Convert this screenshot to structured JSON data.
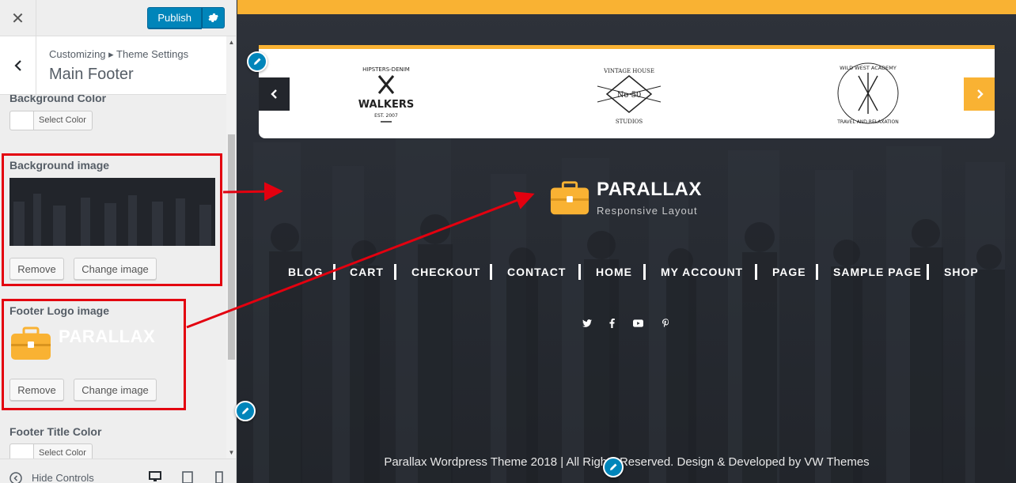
{
  "sidebar": {
    "close_icon": "close-icon",
    "publish_label": "Publish",
    "breadcrumb": "Customizing ▸ Theme Settings",
    "section_title": "Main Footer",
    "controls": {
      "background_color_label": "Background Color",
      "select_color_label": "Select Color",
      "background_image_label": "Background image",
      "remove_label": "Remove",
      "change_image_label": "Change image",
      "footer_logo_label": "Footer Logo image",
      "logo_preview_name": "PARALLAX",
      "logo_preview_tag": "Responsive Layout",
      "footer_title_color_label": "Footer Title Color",
      "select_color_label_2": "Select Color"
    },
    "hide_controls": "Hide Controls"
  },
  "preview": {
    "footer_logo": {
      "name": "PARALLAX",
      "tagline": "Responsive Layout"
    },
    "nav": [
      "BLOG",
      "CART",
      "CHECKOUT",
      "CONTACT",
      "HOME",
      "MY ACCOUNT",
      "PAGE",
      "SAMPLE PAGE",
      "SHOP"
    ],
    "social": [
      "twitter-icon",
      "facebook-icon",
      "youtube-icon",
      "pinterest-icon"
    ],
    "copyright": "Parallax Wordpress Theme 2018 | All Rights Reserved. Design & Developed by VW Themes",
    "brands": [
      {
        "top": "HIPSTERS-DENIM",
        "name": "WALKERS",
        "sub": "EST. 2007"
      },
      {
        "top": "VINTAGE HOUSE",
        "name": "No 50",
        "sub": "STUDIOS"
      },
      {
        "top": "WILD WEST ACADEMY",
        "name": "",
        "sub": "TRAVEL AND RELAXATION"
      }
    ]
  },
  "colors": {
    "accent": "#f9b233",
    "wp_blue": "#0085ba",
    "highlight": "#e3000f",
    "dark": "#23262c"
  }
}
